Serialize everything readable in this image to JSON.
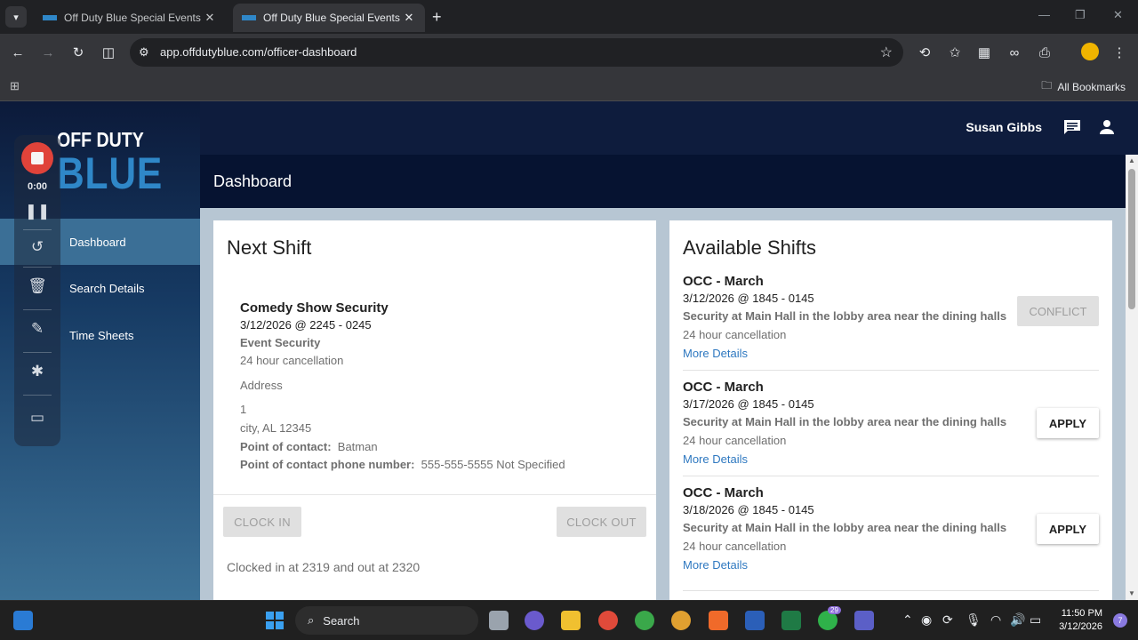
{
  "browser": {
    "tabs": [
      {
        "title": "Off Duty Blue Special Events &",
        "active": false
      },
      {
        "title": "Off Duty Blue Special Events &",
        "active": true
      }
    ],
    "url_host": "app.offdutyblue.com",
    "url_path": "/officer-dashboard",
    "bookmarks_label": "All Bookmarks"
  },
  "app": {
    "logo_line1": "OFF DUTY",
    "logo_line2": "BLUE",
    "user_name": "Susan Gibbs",
    "page_title": "Dashboard",
    "nav": [
      {
        "label": "Dashboard",
        "active": true
      },
      {
        "label": "Search Details",
        "active": false
      },
      {
        "label": "Time Sheets",
        "active": false
      }
    ]
  },
  "recorder": {
    "time": "0:00"
  },
  "next_shift": {
    "heading": "Next Shift",
    "name": "Comedy Show Security",
    "datetime": "3/12/2026 @ 2245 - 0245",
    "type": "Event Security",
    "cancellation": "24 hour cancellation",
    "address_label": "Address",
    "address_line1": "1",
    "address_line2": "city, AL 12345",
    "poc_label": "Point of contact:",
    "poc_value": "Batman",
    "poc_phone_label": "Point of contact phone number:",
    "poc_phone_value": "555-555-5555 Not Specified",
    "clock_in_label": "CLOCK IN",
    "clock_out_label": "CLOCK OUT",
    "clock_status": "Clocked in at 2319 and out at 2320"
  },
  "available_shifts": {
    "heading": "Available Shifts",
    "items": [
      {
        "title": "OCC - March",
        "datetime": "3/12/2026 @ 1845 - 0145",
        "description": "Security at Main Hall in the lobby area near the dining halls",
        "cancellation": "24 hour cancellation",
        "more": "More Details",
        "action": "CONFLICT"
      },
      {
        "title": "OCC - March",
        "datetime": "3/17/2026 @ 1845 - 0145",
        "description": "Security at Main Hall in the lobby area near the dining halls",
        "cancellation": "24 hour cancellation",
        "more": "More Details",
        "action": "APPLY"
      },
      {
        "title": "OCC - March",
        "datetime": "3/18/2026 @ 1845 - 0145",
        "description": "Security at Main Hall in the lobby area near the dining halls",
        "cancellation": "24 hour cancellation",
        "more": "More Details",
        "action": "APPLY"
      }
    ]
  },
  "taskbar": {
    "search_label": "Search",
    "time": "11:50 PM",
    "date": "3/12/2026",
    "whatsapp_badge": "29",
    "notification_count": "7"
  },
  "colors": {
    "app_bar": "#0e1c3d",
    "title_bar": "#061331",
    "nav_active": "#3b6f96",
    "link": "#2e78c0",
    "logo_blue": "#2f87c8"
  }
}
